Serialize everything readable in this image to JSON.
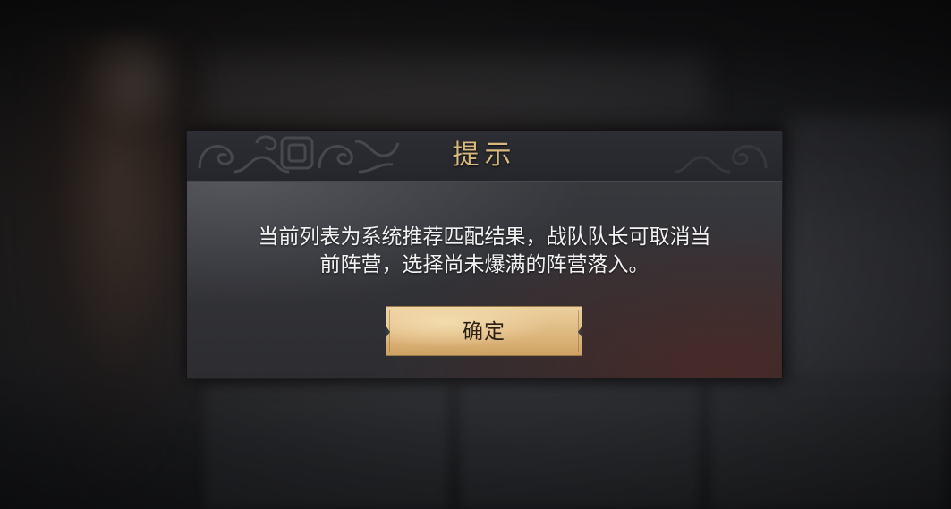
{
  "dialog": {
    "title": "提示",
    "message_line1": "当前列表为系统推荐匹配结果，战队队长可取消当",
    "message_line2": "前阵营，选择尚未爆满的阵营落入。",
    "confirm_label": "确定"
  },
  "colors": {
    "title_gold": "#d8b87c",
    "button_gold": "#ddb67c",
    "message_text": "#f2f2f2"
  },
  "icons": {
    "header_ornament": "cloud-scroll-pattern"
  }
}
